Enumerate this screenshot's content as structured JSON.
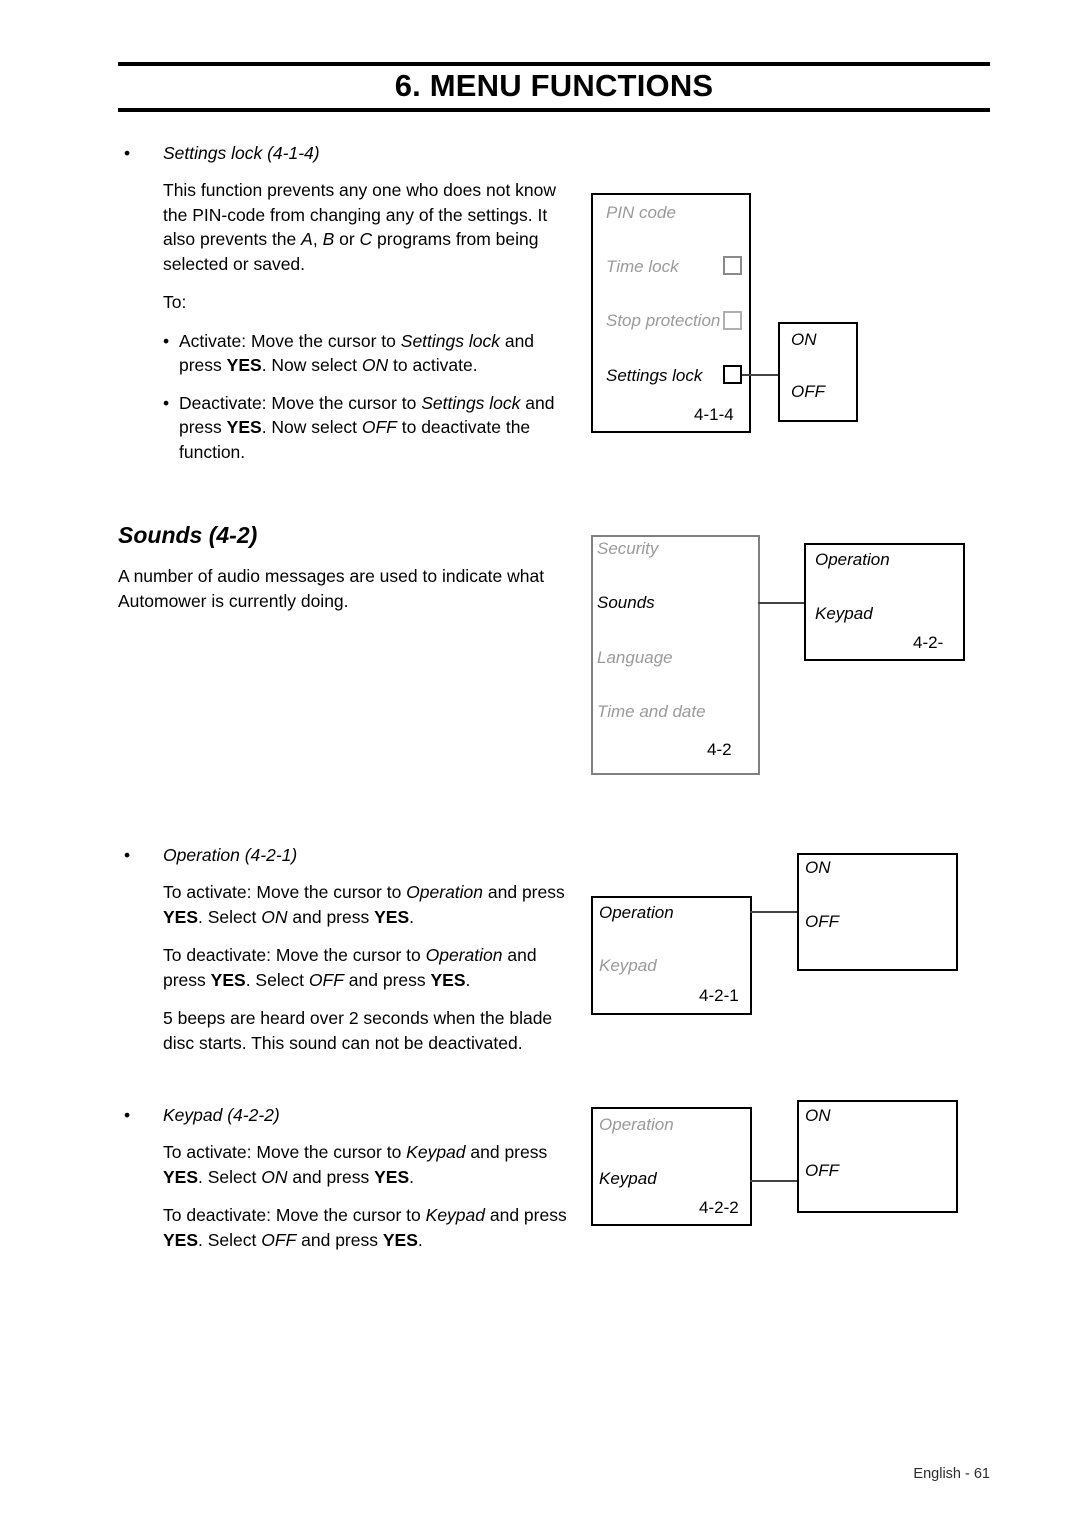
{
  "header": {
    "title": "6. MENU FUNCTIONS"
  },
  "footer": {
    "text": "English - 61"
  },
  "bullet_glyph": "•",
  "content": {
    "settings_lock": {
      "heading": "Settings lock (4-1-4)",
      "paragraph_1_parts": {
        "a": "This function prevents any one who does not know the PIN-code from changing any of the settings. It also prevents the ",
        "em1": "A",
        "b": ", ",
        "em2": "B",
        "c": " or ",
        "em3": "C",
        "d": " programs from being selected or saved."
      },
      "to_label": "To:",
      "items": [
        {
          "a": "Activate: Move the cursor to ",
          "em1": "Settings lock",
          "b": " and press ",
          "strong1": "YES",
          "c": ". Now select ",
          "em2": "ON",
          "d": " to activate."
        },
        {
          "a": "Deactivate: Move the cursor to ",
          "em1": "Settings lock",
          "b": " and press ",
          "strong1": "YES",
          "c": ". Now select ",
          "em2": "OFF",
          "d": " to deactivate the function."
        }
      ]
    },
    "sounds": {
      "heading": "Sounds (4-2)",
      "paragraph": "A number of audio messages are used to indicate what Automower is currently doing."
    },
    "operation": {
      "heading": "Operation (4-2-1)",
      "paragraph_1": {
        "a": "To activate: Move the cursor to ",
        "em1": "Operation",
        "b": " and press ",
        "strong1": "YES",
        "c": ". Select ",
        "em2": "ON",
        "d": " and press ",
        "strong2": "YES",
        "e": "."
      },
      "paragraph_2": {
        "a": "To deactivate: Move the cursor to ",
        "em1": "Operation",
        "b": " and press ",
        "strong1": "YES",
        "c": ". Select ",
        "em2": "OFF",
        "d": " and press ",
        "strong2": "YES",
        "e": "."
      },
      "paragraph_3": "5 beeps are heard over 2 seconds when the blade disc starts. This sound can not be deactivated."
    },
    "keypad": {
      "heading": "Keypad (4-2-2)",
      "paragraph_1": {
        "a": "To activate: Move the cursor to ",
        "em1": "Keypad",
        "b": " and press ",
        "strong1": "YES",
        "c": ". Select ",
        "em2": "ON",
        "d": " and press ",
        "strong2": "YES",
        "e": "."
      },
      "paragraph_2": {
        "a": "To deactivate: Move the cursor to ",
        "em1": "Keypad",
        "b": " and press ",
        "strong1": "YES",
        "c": ". Select ",
        "em2": "OFF",
        "d": " and press ",
        "strong2": "YES",
        "e": "."
      }
    }
  },
  "diagrams": {
    "settings_lock_menu": {
      "items": [
        {
          "label": "PIN code",
          "state": "off",
          "checkbox": false
        },
        {
          "label": "Time lock",
          "state": "off",
          "checkbox": true
        },
        {
          "label": "Stop protection",
          "state": "off",
          "checkbox": true
        },
        {
          "label": "Settings lock",
          "state": "on",
          "checkbox": true
        }
      ],
      "code": "4-1-4",
      "target": {
        "options": [
          "ON",
          "OFF"
        ]
      }
    },
    "sounds_menu": {
      "items": [
        {
          "label": "Security",
          "state": "off"
        },
        {
          "label": "Sounds",
          "state": "on"
        },
        {
          "label": "Language",
          "state": "off"
        },
        {
          "label": "Time and date",
          "state": "off"
        }
      ],
      "code": "4-2",
      "target": {
        "items": [
          {
            "label": "Operation",
            "state": "on"
          },
          {
            "label": "Keypad",
            "state": "on"
          }
        ],
        "code": "4-2-"
      }
    },
    "operation_menu": {
      "items": [
        {
          "label": "Operation",
          "state": "on"
        },
        {
          "label": "Keypad",
          "state": "off"
        }
      ],
      "code": "4-2-1",
      "target": {
        "options": [
          "ON",
          "OFF"
        ]
      }
    },
    "keypad_menu": {
      "items": [
        {
          "label": "Operation",
          "state": "off"
        },
        {
          "label": "Keypad",
          "state": "on"
        }
      ],
      "code": "4-2-2",
      "target": {
        "options": [
          "ON",
          "OFF"
        ]
      }
    }
  }
}
